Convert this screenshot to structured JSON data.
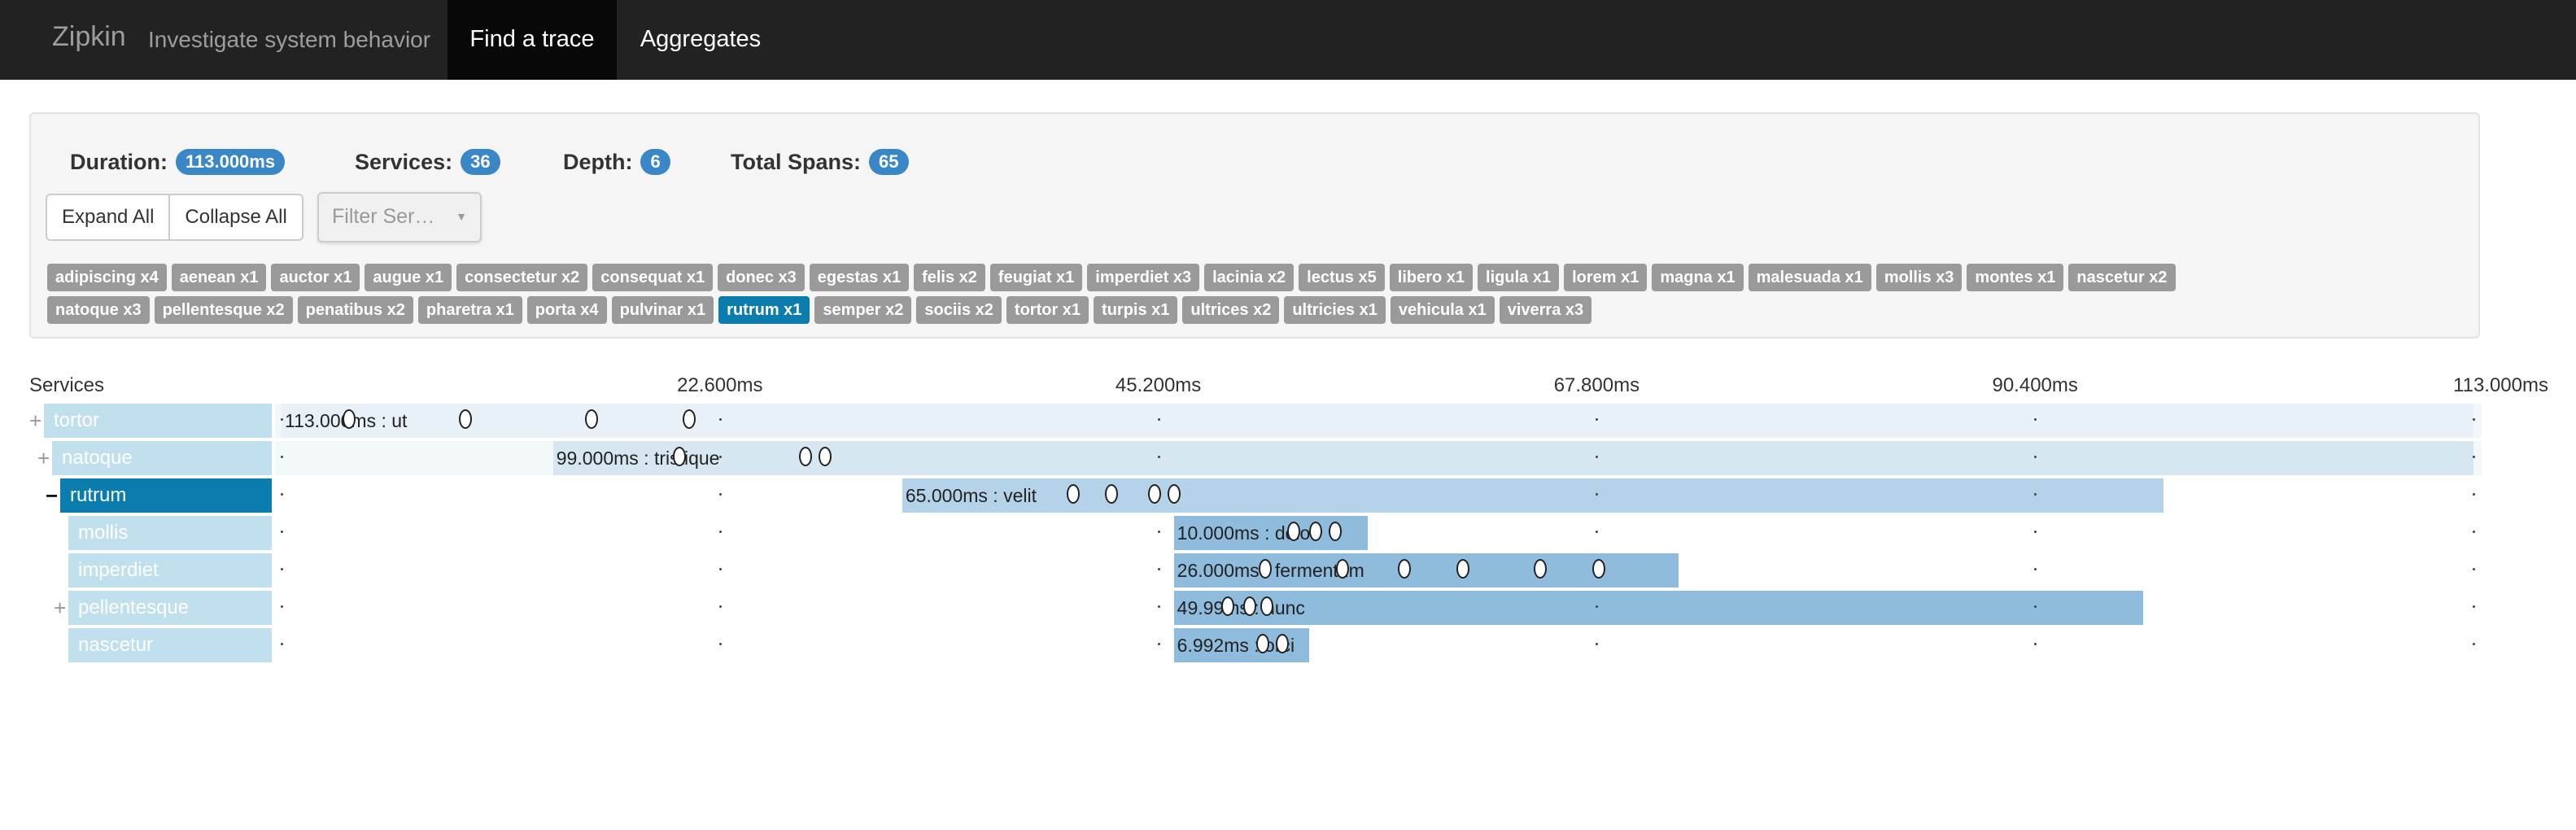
{
  "navbar": {
    "brand": "Zipkin",
    "subtitle": "Investigate system behavior",
    "nav_find": "Find a trace",
    "nav_aggregates": "Aggregates"
  },
  "summary": {
    "duration_label": "Duration:",
    "duration_value": "113.000ms",
    "services_label": "Services:",
    "services_value": "36",
    "depth_label": "Depth:",
    "depth_value": "6",
    "total_spans_label": "Total Spans:",
    "total_spans_value": "65"
  },
  "buttons": {
    "expand_all": "Expand All",
    "collapse_all": "Collapse All"
  },
  "filter": {
    "placeholder": "Filter Ser…",
    "caret": "▼"
  },
  "service_tags": [
    "adipiscing x4",
    "aenean x1",
    "auctor x1",
    "augue x1",
    "consectetur x2",
    "consequat x1",
    "donec x3",
    "egestas x1",
    "felis x2",
    "feugiat x1",
    "imperdiet x3",
    "lacinia x2",
    "lectus x5",
    "libero x1",
    "ligula x1",
    "lorem x1",
    "magna x1",
    "malesuada x1",
    "mollis x3",
    "montes x1",
    "nascetur x2",
    "natoque x3",
    "pellentesque x2",
    "penatibus x2",
    "pharetra x1",
    "porta x4",
    "pulvinar x1",
    "rutrum x1",
    "semper x2",
    "sociis x2",
    "tortor x1",
    "turpis x1",
    "ultrices x2",
    "ultricies x1",
    "vehicula x1",
    "viverra x3"
  ],
  "active_tag": "rutrum x1",
  "timeline": {
    "services_header": "Services",
    "total_ms": 113,
    "ticks": [
      "22.600ms",
      "45.200ms",
      "67.800ms",
      "90.400ms",
      "113.000ms"
    ]
  },
  "spans": [
    {
      "service": "tortor",
      "expander": "+",
      "depth": 0,
      "start_ms": 0,
      "duration_ms": 113,
      "label": "113.000ms : ut",
      "color": "#e8f1f8",
      "selected": false,
      "annotations": [
        3.5,
        9.5,
        16,
        21
      ]
    },
    {
      "service": "natoque",
      "expander": "+",
      "depth": 1,
      "start_ms": 14.0,
      "duration_ms": 99,
      "label": "99.000ms : tristique",
      "color": "#d6e7f2",
      "selected": false,
      "annotations": [
        20.5,
        27,
        28
      ]
    },
    {
      "service": "rutrum",
      "expander": "−",
      "depth": 2,
      "start_ms": 32.0,
      "duration_ms": 65,
      "label": "65.000ms : velit",
      "color": "#b5d3e8",
      "selected": true,
      "annotations": [
        40.8,
        42.8,
        45,
        46
      ]
    },
    {
      "service": "mollis",
      "expander": "",
      "depth": 3,
      "start_ms": 46.0,
      "duration_ms": 10,
      "label": "10.000ms : dolor",
      "color": "#8fbcdc",
      "selected": false,
      "annotations": [
        52.2,
        53.3,
        54.3
      ]
    },
    {
      "service": "imperdiet",
      "expander": "",
      "depth": 3,
      "start_ms": 46.0,
      "duration_ms": 26,
      "label": "26.000ms : fermentum",
      "color": "#8fbcdc",
      "selected": false,
      "annotations": [
        50.7,
        54.7,
        57.9,
        60.9,
        64.9,
        67.9
      ]
    },
    {
      "service": "pellentesque",
      "expander": "+",
      "depth": 3,
      "start_ms": 46.0,
      "duration_ms": 49.99,
      "label": "49.99ms : nunc",
      "color": "#8fbcdc",
      "selected": false,
      "annotations": [
        48.8,
        49.9,
        50.8
      ]
    },
    {
      "service": "nascetur",
      "expander": "",
      "depth": 3,
      "start_ms": 46.0,
      "duration_ms": 6.992,
      "label": "6.992ms : orci",
      "color": "#8fbcdc",
      "selected": false,
      "annotations": [
        50.6,
        51.6
      ]
    }
  ]
}
